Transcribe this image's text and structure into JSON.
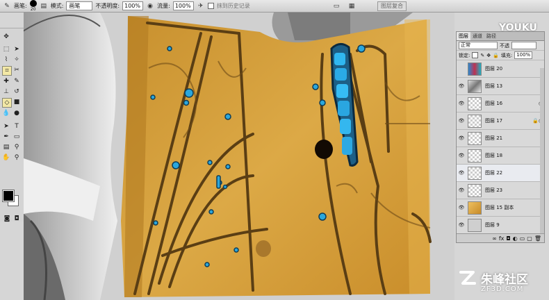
{
  "options_bar": {
    "brush_label": "画笔:",
    "brush_size": "20",
    "mode_label": "模式:",
    "mode_value": "画笔",
    "opacity_label": "不透明度:",
    "opacity_value": "100%",
    "flow_label": "流量:",
    "flow_value": "100%",
    "erase_history_label": "抹到历史记录",
    "workspace_label": "图层复合"
  },
  "watermark": "YOUKU",
  "layers_panel": {
    "tabs": [
      "图层",
      "通道",
      "路径"
    ],
    "blend_mode": "正常",
    "opacity_label": "不透",
    "lock_label": "锁定:",
    "fill_label": "填充:",
    "fill_value": "100%",
    "layers": [
      {
        "name": "图层 20",
        "visible": false,
        "selected": false,
        "fx": ""
      },
      {
        "name": "图层 13",
        "visible": true,
        "selected": false,
        "fx": ""
      },
      {
        "name": "图层 16",
        "visible": true,
        "selected": false,
        "fx": "◎"
      },
      {
        "name": "图层 17",
        "visible": true,
        "selected": false,
        "fx": "🔒◎"
      },
      {
        "name": "图层 21",
        "visible": true,
        "selected": false,
        "fx": ""
      },
      {
        "name": "图层 18",
        "visible": true,
        "selected": false,
        "fx": ""
      },
      {
        "name": "图层 22",
        "visible": true,
        "selected": true,
        "fx": ""
      },
      {
        "name": "图层 23",
        "visible": true,
        "selected": false,
        "fx": ""
      },
      {
        "name": "图层 15 副本",
        "visible": true,
        "selected": false,
        "fx": ""
      },
      {
        "name": "图层 9",
        "visible": true,
        "selected": false,
        "fx": ""
      }
    ]
  },
  "logo": {
    "text": "朱峰社区",
    "sub": "ZF3D.COM"
  }
}
